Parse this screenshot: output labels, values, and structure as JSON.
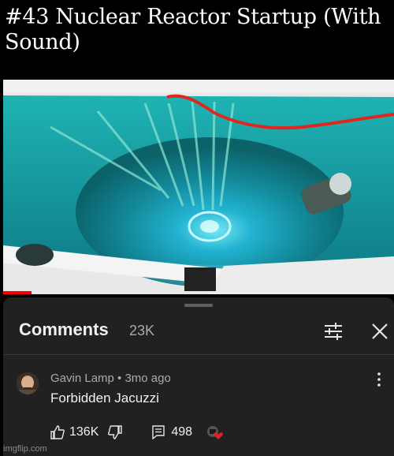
{
  "meme": {
    "title": "#43 Nuclear Reactor Startup (With Sound)"
  },
  "comments": {
    "heading": "Comments",
    "count": "23K"
  },
  "comment": {
    "author_meta": "Gavin Lamp • 3mo ago",
    "text": "Forbidden Jacuzzi",
    "likes": "136K",
    "replies": "498"
  },
  "watermark": "imgflip.com",
  "colors": {
    "sheet_background": "#212121",
    "heart": "#e0202a",
    "progress": "#ff0000"
  },
  "icons": [
    "sort-icon",
    "close-icon",
    "more-vert-icon",
    "thumb-up-icon",
    "thumb-down-icon",
    "reply-icon",
    "creator-heart-icon"
  ]
}
